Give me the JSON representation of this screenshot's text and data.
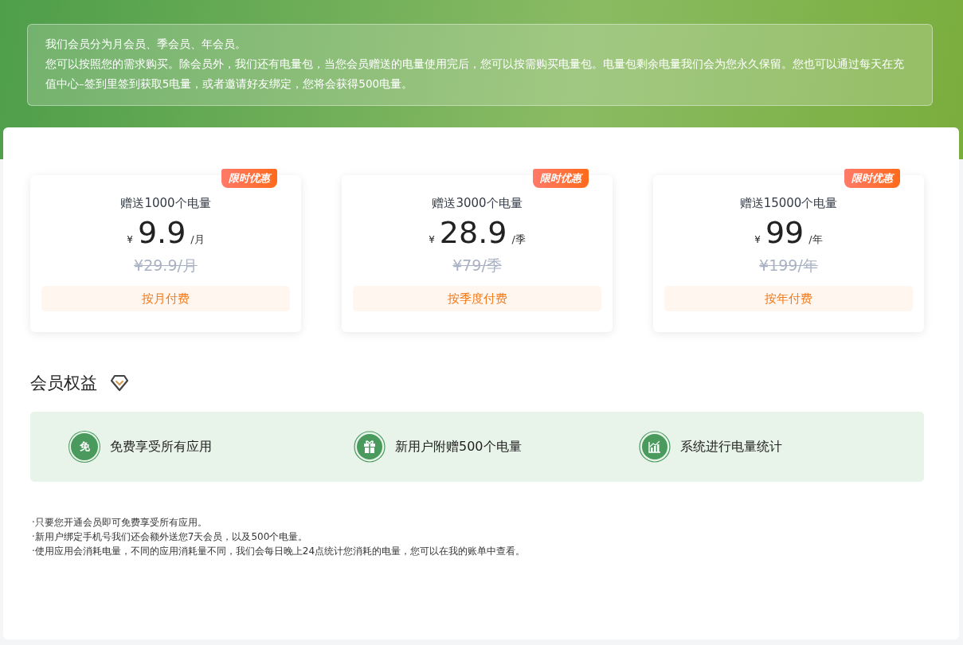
{
  "intro": {
    "lines": [
      "我们会员分为月会员、季会员、年会员。",
      "您可以按照您的需求购买。除会员外，我们还有电量包，当您会员赠送的电量使用完后，您可以按需购买电量包。电量包剩余电量我们会为您永久保留。您也可以通过每天在充值中心–签到里签到获取5电量，或者邀请好友绑定，您将会获得500电量。"
    ]
  },
  "plans": [
    {
      "badge": "限时优惠",
      "gift": "赠送1000个电量",
      "currency": "¥",
      "price": "9.9",
      "unit": "/月",
      "original": "¥29.9/月",
      "button": "按月付费"
    },
    {
      "badge": "限时优惠",
      "gift": "赠送3000个电量",
      "currency": "¥",
      "price": "28.9",
      "unit": "/季",
      "original": "¥79/季",
      "button": "按季度付费"
    },
    {
      "badge": "限时优惠",
      "gift": "赠送15000个电量",
      "currency": "¥",
      "price": "99",
      "unit": "/年",
      "original": "¥199/年",
      "button": "按年付费"
    }
  ],
  "benefits": {
    "title": "会员权益",
    "items": [
      {
        "kind": "text",
        "glyph": "免",
        "label": "免费享受所有应用"
      },
      {
        "kind": "gift",
        "label": "新用户附赠500个电量"
      },
      {
        "kind": "chart",
        "label": "系统进行电量统计"
      }
    ]
  },
  "notes": [
    "·只要您开通会员即可免费享受所有应用。",
    "·新用户绑定手机号我们还会额外送您7天会员，以及500个电量。",
    "·使用应用会消耗电量，不同的应用消耗量不同，我们会每日晚上24点统计您消耗的电量，您可以在我的账单中查看。"
  ]
}
